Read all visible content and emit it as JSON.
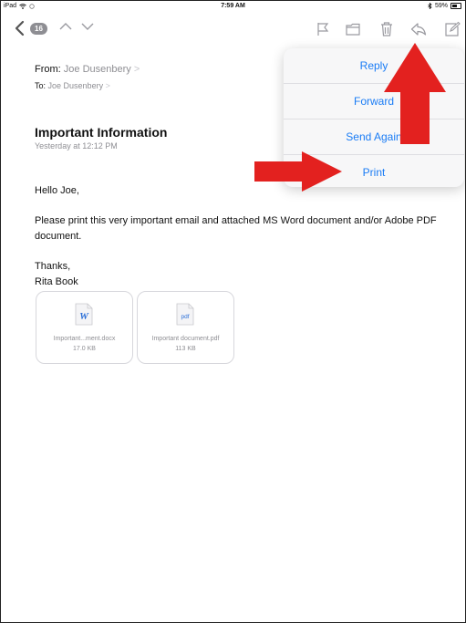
{
  "status": {
    "device": "iPad",
    "time": "7:59 AM",
    "battery": "59%"
  },
  "toolbar": {
    "message_count": "16"
  },
  "mail": {
    "from_label": "From:",
    "from_name": "Joe Dusenbery",
    "to_label": "To:",
    "to_name": "Joe Dusenbery",
    "subject": "Important Information",
    "date": "Yesterday at 12:12 PM",
    "greeting": "Hello Joe,",
    "body": "Please print this very important email and attached MS Word document and/or Adobe PDF document.",
    "thanks": "Thanks,",
    "signature": "Rita Book"
  },
  "attachments": [
    {
      "icon": "word-doc-icon",
      "icon_text": "W",
      "name": "Important...ment.docx",
      "size": "17.0 KB"
    },
    {
      "icon": "pdf-doc-icon",
      "icon_text": "pdf",
      "name": "Important document.pdf",
      "size": "113 KB"
    }
  ],
  "reply_menu": {
    "items": [
      "Reply",
      "Forward",
      "Send Again",
      "Print"
    ]
  },
  "colors": {
    "accent": "#1a7cf5",
    "arrow": "#e3211f",
    "gray_text": "#8e8e93"
  }
}
